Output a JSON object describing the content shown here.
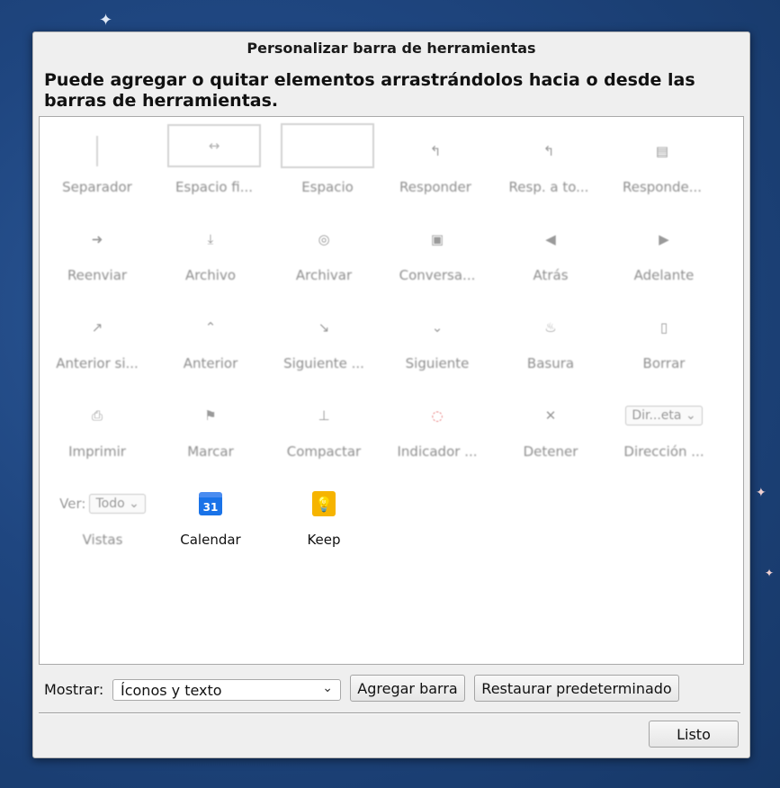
{
  "dialog": {
    "title": "Personalizar barra de herramientas",
    "instructions": "Puede agregar o quitar elementos arrastrándolos hacia o desde las barras de herramientas."
  },
  "palette": {
    "items": [
      {
        "label": "Separador",
        "icon": "separator-icon"
      },
      {
        "label": "Espacio fi...",
        "icon": "fixed-space-icon",
        "glyph": "↔"
      },
      {
        "label": "Espacio",
        "icon": "flexible-space-icon"
      },
      {
        "label": "Responder",
        "icon": "reply-icon",
        "glyph": "↰"
      },
      {
        "label": "Resp. a to...",
        "icon": "reply-all-icon",
        "glyph": "↰"
      },
      {
        "label": "Responde...",
        "icon": "reply-list-icon",
        "glyph": "▤"
      },
      {
        "label": "Reenviar",
        "icon": "forward-icon",
        "glyph": "➜"
      },
      {
        "label": "Archivo",
        "icon": "file-icon",
        "glyph": "⤓"
      },
      {
        "label": "Archivar",
        "icon": "archive-icon",
        "glyph": "◎"
      },
      {
        "label": "Conversa...",
        "icon": "conversation-icon",
        "glyph": "▣"
      },
      {
        "label": "Atrás",
        "icon": "back-icon",
        "glyph": "◀"
      },
      {
        "label": "Adelante",
        "icon": "forward-arrow-icon",
        "glyph": "▶"
      },
      {
        "label": "Anterior si...",
        "icon": "previous-unread-icon",
        "glyph": "↗"
      },
      {
        "label": "Anterior",
        "icon": "previous-icon",
        "glyph": "⌃"
      },
      {
        "label": "Siguiente ...",
        "icon": "next-unread-icon",
        "glyph": "↘"
      },
      {
        "label": "Siguiente",
        "icon": "next-icon",
        "glyph": "⌄"
      },
      {
        "label": "Basura",
        "icon": "junk-icon",
        "glyph": "♨"
      },
      {
        "label": "Borrar",
        "icon": "delete-icon",
        "glyph": "▯"
      },
      {
        "label": "Imprimir",
        "icon": "print-icon",
        "glyph": "⎙"
      },
      {
        "label": "Marcar",
        "icon": "tag-icon",
        "glyph": "⚑"
      },
      {
        "label": "Compactar",
        "icon": "compact-icon",
        "glyph": "⊥"
      },
      {
        "label": "Indicador ...",
        "icon": "throbber-icon",
        "glyph": "◌"
      },
      {
        "label": "Detener",
        "icon": "stop-icon",
        "glyph": "✕"
      },
      {
        "label": "Dirección ...",
        "icon": "address-book-icon"
      },
      {
        "label": "Vistas",
        "icon": "views-icon"
      },
      {
        "label": "Calendar",
        "icon": "calendar-icon",
        "glyph": "31"
      },
      {
        "label": "Keep",
        "icon": "keep-icon",
        "glyph": "💡"
      }
    ],
    "address_select_text": "Dir...eta",
    "views_label": "Ver:",
    "views_select_text": "Todo"
  },
  "footer": {
    "show_label": "Mostrar:",
    "show_value": "Íconos y texto",
    "add_bar_button": "Agregar barra",
    "restore_button": "Restaurar predeterminado",
    "done_button": "Listo"
  }
}
